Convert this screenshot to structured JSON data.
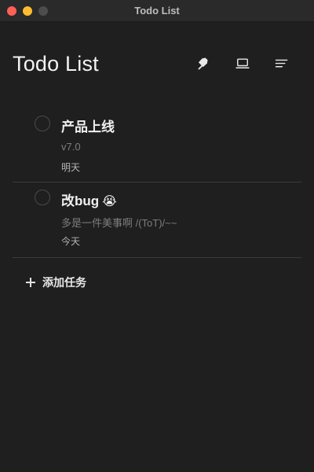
{
  "window": {
    "title": "Todo List"
  },
  "header": {
    "title": "Todo List",
    "icons": [
      "pin-icon",
      "laptop-icon",
      "sort-menu-icon"
    ]
  },
  "tasks": [
    {
      "title": "产品上线",
      "note": "v7.0",
      "date": "明天",
      "completed": false
    },
    {
      "title": "改bug",
      "emoji": "😭",
      "note": "多是一件美事啊 /(ToT)/~~",
      "date": "今天",
      "completed": false
    }
  ],
  "add_task": {
    "label": "添加任务"
  },
  "colors": {
    "background": "#1f1f1f",
    "title_bar": "#2a2a2a",
    "divider": "#3a3a3a",
    "text_primary": "#f0f0f0",
    "text_secondary": "#7d7d7d"
  }
}
